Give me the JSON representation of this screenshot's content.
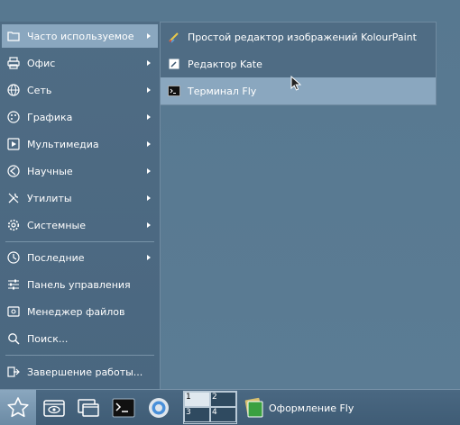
{
  "main_menu": {
    "items": [
      {
        "label": "Часто используемое",
        "icon": "folder-icon",
        "submenu": true,
        "active": true
      },
      {
        "label": "Офис",
        "icon": "printer-icon",
        "submenu": true
      },
      {
        "label": "Сеть",
        "icon": "globe-icon",
        "submenu": true
      },
      {
        "label": "Графика",
        "icon": "palette-icon",
        "submenu": true
      },
      {
        "label": "Мультимедиа",
        "icon": "media-play-icon",
        "submenu": true
      },
      {
        "label": "Научные",
        "icon": "atom-icon",
        "submenu": true
      },
      {
        "label": "Утилиты",
        "icon": "tools-icon",
        "submenu": true
      },
      {
        "label": "Системные",
        "icon": "gear-icon",
        "submenu": true
      },
      {
        "label": "Последние",
        "icon": "clock-icon",
        "submenu": true
      },
      {
        "label": "Панель управления",
        "icon": "sliders-icon",
        "submenu": false
      },
      {
        "label": "Менеджер файлов",
        "icon": "file-manager-icon",
        "submenu": false
      },
      {
        "label": "Поиск...",
        "icon": "search-icon",
        "submenu": false
      },
      {
        "label": "Завершение работы...",
        "icon": "logout-icon",
        "submenu": false
      }
    ]
  },
  "submenu": {
    "items": [
      {
        "label": "Простой редактор изображений KolourPaint",
        "icon": "paint-brush-icon"
      },
      {
        "label": "Редактор Kate",
        "icon": "text-editor-icon"
      },
      {
        "label": "Терминал Fly",
        "icon": "terminal-icon",
        "active": true
      }
    ]
  },
  "taskbar": {
    "pager_labels": [
      "1",
      "2",
      "3",
      "4"
    ],
    "active_desktop": "1",
    "task_label": "Оформление Fly"
  },
  "colors": {
    "menu_bg": "#4f6c84",
    "highlight": "#8aa7bf",
    "desktop": "#5a7b94"
  }
}
